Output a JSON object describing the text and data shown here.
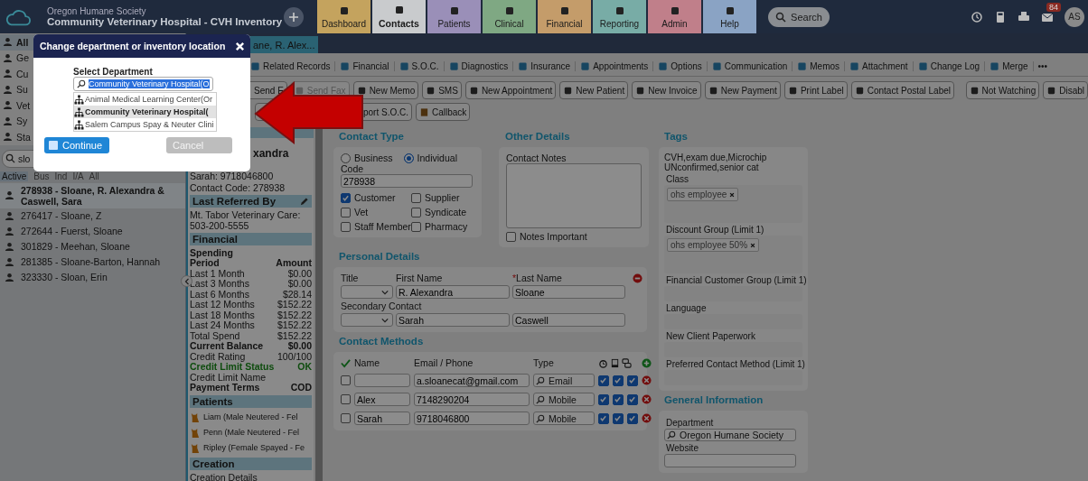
{
  "header": {
    "org": "Oregon Humane Society",
    "title": "Community Veterinary Hospital - CVH Inventory",
    "nav": [
      {
        "label": "Dashboard",
        "color": "#c4a35e",
        "selected": false
      },
      {
        "label": "Contacts",
        "color": "#c9cbcd",
        "selected": true
      },
      {
        "label": "Patients",
        "color": "#9a8fb8",
        "selected": false
      },
      {
        "label": "Clinical",
        "color": "#7fa883",
        "selected": false
      },
      {
        "label": "Financial",
        "color": "#c49c6a",
        "selected": false
      },
      {
        "label": "Reporting",
        "color": "#78aca6",
        "selected": false
      },
      {
        "label": "Admin",
        "color": "#c07f8a",
        "selected": false
      },
      {
        "label": "Help",
        "color": "#8aa3c4",
        "selected": false
      }
    ],
    "search": "Search",
    "mail_count": "84",
    "avatar": "AS"
  },
  "sidebar": {
    "categories": [
      {
        "label": "All",
        "selected": true
      },
      {
        "label": "Ge",
        "selected": false
      },
      {
        "label": "Cu",
        "selected": false
      },
      {
        "label": "Su",
        "selected": false
      },
      {
        "label": "Vet",
        "selected": false
      },
      {
        "label": "Sy",
        "selected": false
      },
      {
        "label": "Sta",
        "selected": false
      }
    ],
    "search_value": "slo",
    "filters": [
      {
        "label": "Active",
        "selected": true
      },
      {
        "label": "Bus",
        "selected": false
      },
      {
        "label": "Ind",
        "selected": false
      },
      {
        "label": "I/A",
        "selected": false
      },
      {
        "label": "All",
        "selected": false
      }
    ],
    "contacts": [
      {
        "label": "278938 - Sloane, R. Alexandra & Caswell, Sara",
        "selected": true
      },
      {
        "label": "276417 - Sloane, Z",
        "selected": false
      },
      {
        "label": "272644 - Fuerst, Sloane",
        "selected": false
      },
      {
        "label": "301829 - Meehan, Sloane",
        "selected": false
      },
      {
        "label": "281385 - Sloane-Barton, Hannah",
        "selected": false
      },
      {
        "label": "323330 - Sloan, Erin",
        "selected": false
      }
    ]
  },
  "record_tab": {
    "label": "ane, R. Alex...",
    "selected": true
  },
  "toolbar_primary": [
    "Related Records",
    "Financial",
    "S.O.C.",
    "Diagnostics",
    "Insurance",
    "Appointments",
    "Options",
    "Communication",
    "Memos",
    "Attachment",
    "Change Log",
    "Merge",
    "•••"
  ],
  "toolbar_actions": [
    {
      "label": "Send E",
      "disabled": false
    },
    {
      "label": "Send Fax",
      "disabled": true
    },
    {
      "label": "New Memo",
      "disabled": false
    },
    {
      "label": "SMS",
      "disabled": false
    },
    {
      "label": "New Appointment",
      "disabled": false
    },
    {
      "label": "New Patient",
      "disabled": false
    },
    {
      "label": "New Invoice",
      "disabled": false
    },
    {
      "label": "New Payment",
      "disabled": false
    },
    {
      "label": "Print Label",
      "disabled": false
    },
    {
      "label": "Contact Postal Label",
      "disabled": false
    },
    {
      "label": "Not Watching",
      "disabled": false
    },
    {
      "label": "Disabl",
      "disabled": false
    }
  ],
  "toolbar_secondary": [
    {
      "kind": "icon"
    },
    {
      "kind": "text",
      "label": "port S.O.C."
    },
    {
      "kind": "icon_text",
      "label": "Callback"
    }
  ],
  "summary": {
    "name": "xandra",
    "phone": "Sarah: 9718046800",
    "code": "Contact Code: 278938",
    "referred_header": "Last Referred By",
    "referred": "Mt. Tabor Veterinary Care: 503-200-5555",
    "financial_header": "Financial",
    "spending_label": "Spending",
    "period_header": "Period",
    "amount_header": "Amount",
    "rows": [
      {
        "label": "Last 1 Month",
        "value": "$0.00",
        "kind": "plain"
      },
      {
        "label": "Last 3 Months",
        "value": "$0.00",
        "kind": "plain"
      },
      {
        "label": "Last 6 Months",
        "value": "$28.14",
        "kind": "plain"
      },
      {
        "label": "Last 12 Months",
        "value": "$152.22",
        "kind": "plain"
      },
      {
        "label": "Last 18 Months",
        "value": "$152.22",
        "kind": "plain"
      },
      {
        "label": "Last 24 Months",
        "value": "$152.22",
        "kind": "plain"
      },
      {
        "label": "Total Spend",
        "value": "$152.22",
        "kind": "plain"
      },
      {
        "label": "Current Balance",
        "value": "$0.00",
        "kind": "bold"
      },
      {
        "label": "Credit Rating",
        "value": "100/100",
        "kind": "plain"
      },
      {
        "label": "Credit Limit Status",
        "value": "OK",
        "kind": "good"
      },
      {
        "label": "Credit Limit Name",
        "kind": "plain"
      },
      {
        "label": "Payment Terms",
        "value": "COD",
        "kind": "bold"
      }
    ],
    "patients_header": "Patients",
    "patients": [
      "Liam (Male Neutered - Fel",
      "Penn (Male Neutered - Fel",
      "Ripley (Female Spayed - Fe"
    ],
    "creation_header": "Creation",
    "creation_details": "Creation Details"
  },
  "contact_type": {
    "title": "Contact Type",
    "options": [
      {
        "label": "Business",
        "selected": false
      },
      {
        "label": "Individual",
        "selected": true
      }
    ],
    "code_label": "Code",
    "code": "278938",
    "flags": [
      {
        "label": "Customer",
        "checked": true
      },
      {
        "label": "Supplier",
        "checked": false
      },
      {
        "label": "Vet",
        "checked": false
      },
      {
        "label": "Syndicate",
        "checked": false
      },
      {
        "label": "Staff Member",
        "checked": false
      },
      {
        "label": "Pharmacy",
        "checked": false
      }
    ]
  },
  "other_details": {
    "title": "Other Details",
    "notes_label": "Contact Notes",
    "notes_important": {
      "label": "Notes Important",
      "checked": false
    }
  },
  "personal": {
    "title": "Personal Details",
    "title_label": "Title",
    "first_label": "First Name",
    "last_label": "Last Name",
    "required_mark": "*",
    "first": "R. Alexandra",
    "last": "Sloane",
    "secondary_label": "Secondary Contact",
    "secondary_first": "Sarah",
    "secondary_last": "Caswell"
  },
  "contact_methods": {
    "title": "Contact Methods",
    "columns": [
      "Name",
      "Email / Phone",
      "Type"
    ],
    "rows": [
      {
        "selected": false,
        "value": "a.sloanecat@gmail.com",
        "type": "Email",
        "flags": [
          true,
          true,
          true
        ]
      },
      {
        "selected": false,
        "name": "Alex",
        "value": "7148290204",
        "type": "Mobile",
        "flags": [
          true,
          true,
          true
        ]
      },
      {
        "selected": false,
        "name": "Sarah",
        "value": "9718046800",
        "type": "Mobile",
        "flags": [
          true,
          true,
          true
        ]
      }
    ]
  },
  "tags": {
    "title": "Tags",
    "summary": "CVH,exam due,Microchip UNconfirmed,senior cat",
    "groups": [
      {
        "label": "Class",
        "chips": [
          "ohs employee"
        ]
      },
      {
        "label": "Discount Group (Limit 1)",
        "chips": [
          "ohs employee 50%"
        ]
      },
      {
        "label": "Financial Customer Group (Limit 1)"
      },
      {
        "label": "Language"
      },
      {
        "label": "New Client Paperwork"
      },
      {
        "label": "Preferred Contact Method (Limit 1)"
      }
    ]
  },
  "general": {
    "title": "General Information",
    "department_label": "Department",
    "department": "Oregon Humane Society",
    "website_label": "Website"
  },
  "modal": {
    "title": "Change department or inventory location",
    "label": "Select Department",
    "search_value": "Community Veterinary Hospital(O",
    "options": [
      {
        "label": "Animal Medical Learning Center(Or",
        "selected": false
      },
      {
        "label": "Community Veterinary Hospital(",
        "selected": true
      },
      {
        "label": "Salem Campus Spay & Neuter Clini",
        "selected": false
      }
    ],
    "continue": "Continue",
    "cancel": "Cancel"
  }
}
